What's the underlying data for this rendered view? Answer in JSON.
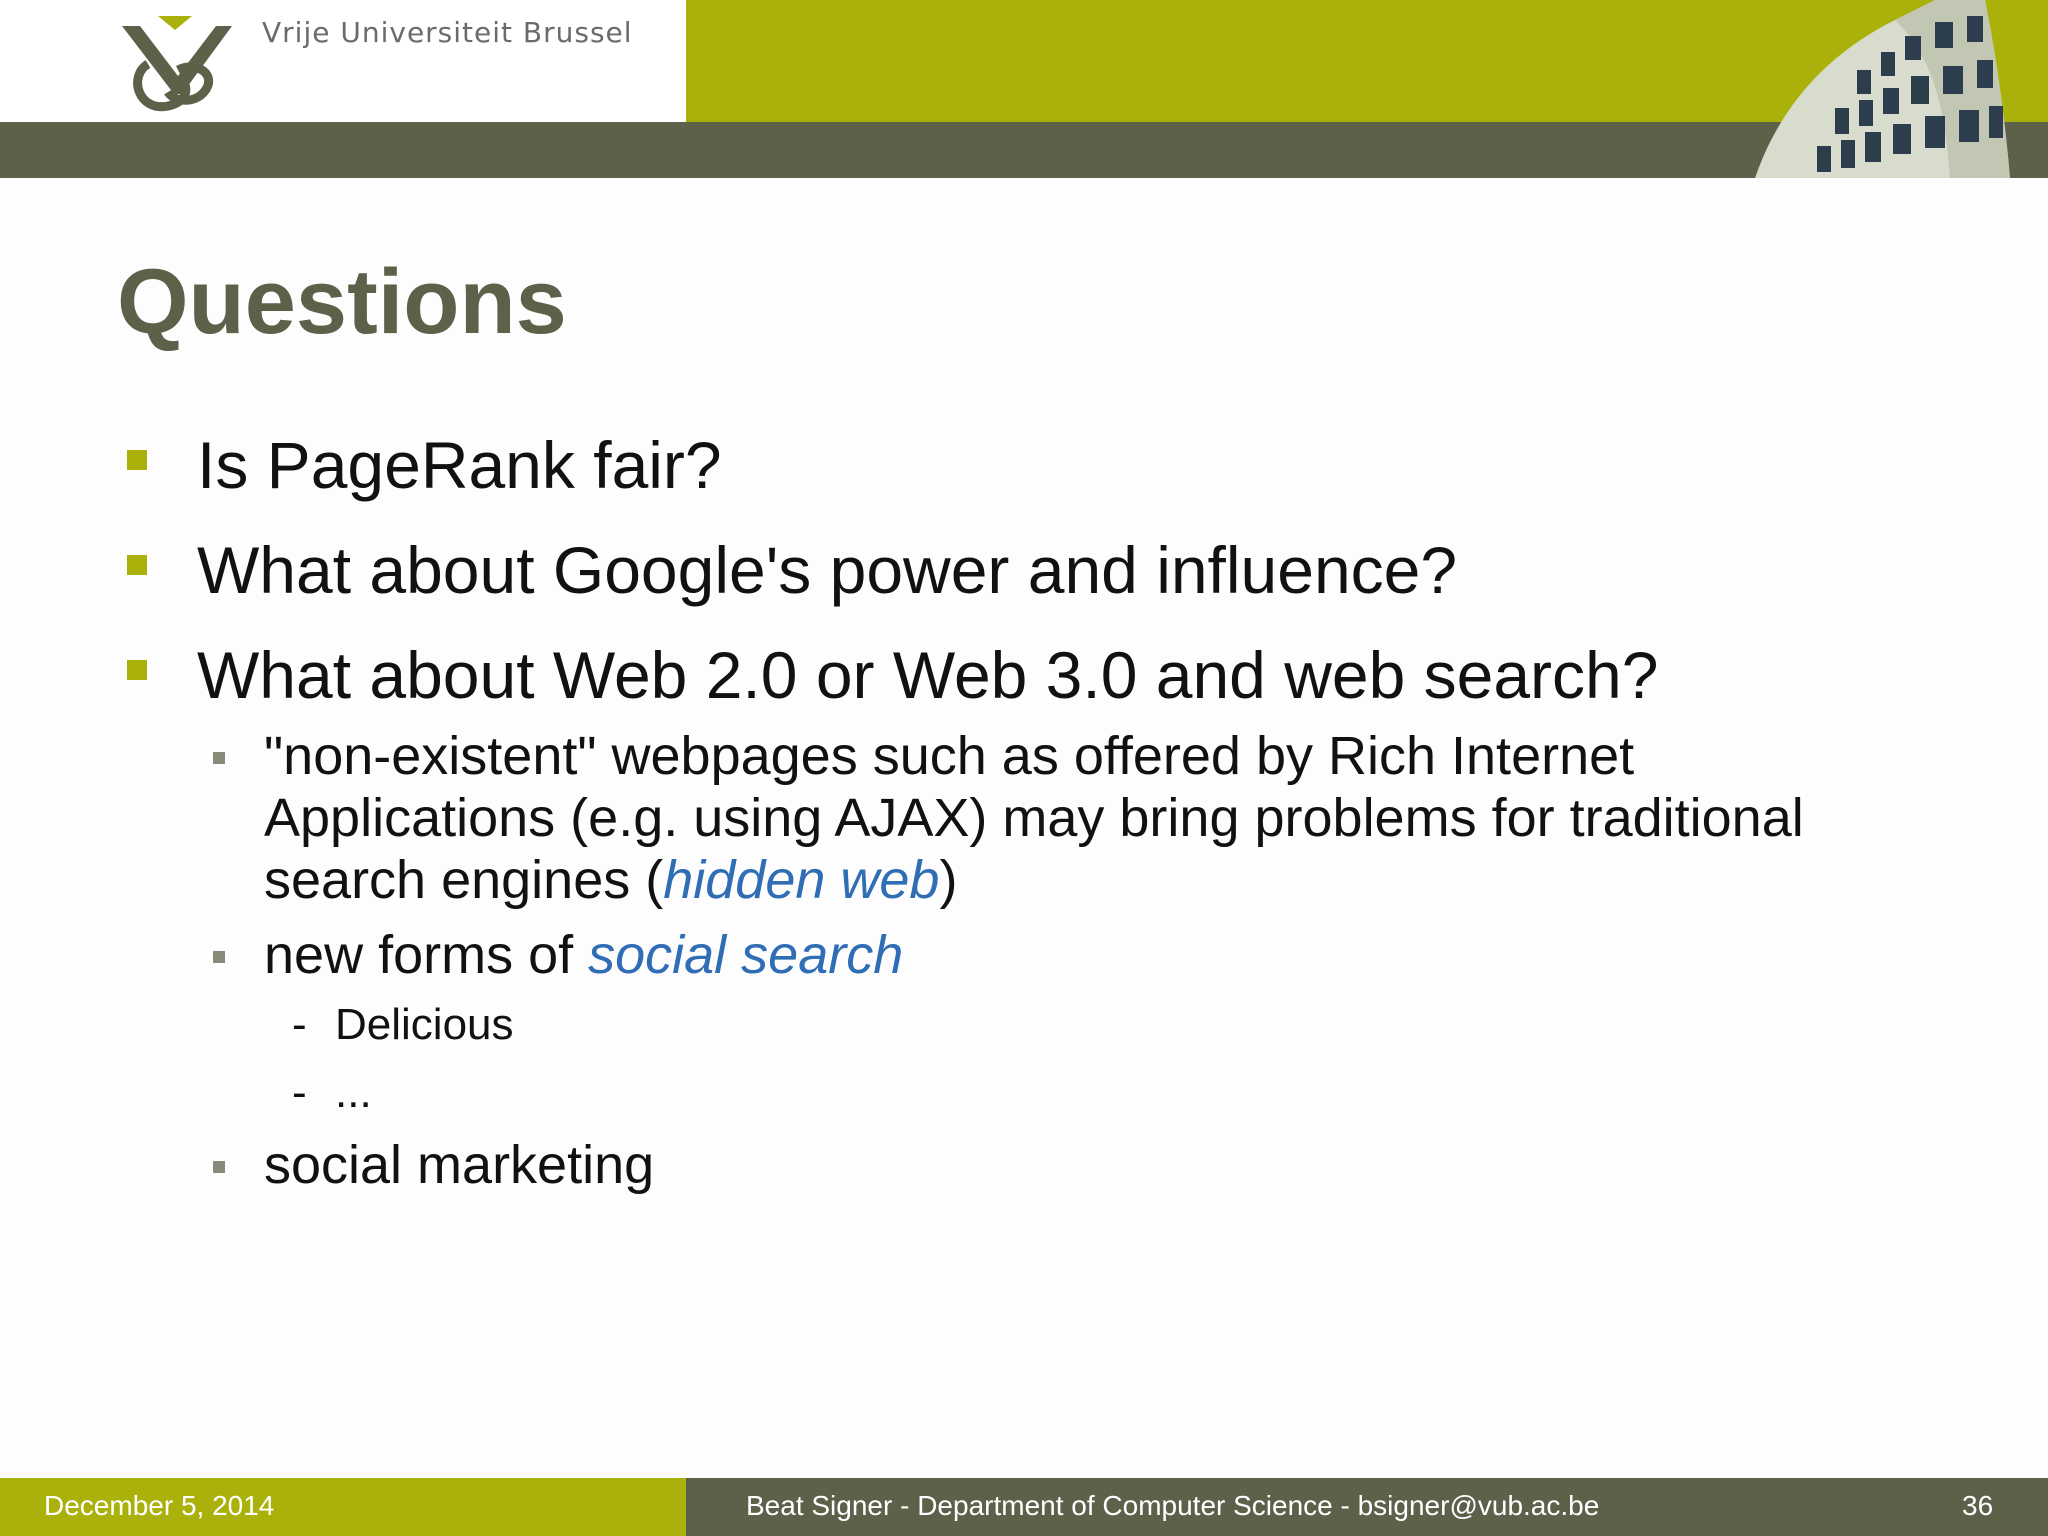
{
  "header": {
    "university": "Vrije Universiteit  Brussel"
  },
  "slide": {
    "title": "Questions",
    "bullets": [
      "Is PageRank fair?",
      "What about Google's power and influence?",
      "What about Web 2.0 or Web 3.0 and web search?"
    ],
    "sub": {
      "hidden_line1": "\"non-existent\" webpages such as offered by Rich Internet",
      "hidden_line2": "Applications (e.g. using AJAX) may bring problems for traditional",
      "hidden_line3_pre": "search engines (",
      "hidden_term": "hidden web",
      "hidden_line3_post": ")",
      "social_pre": "new forms of ",
      "social_term": "social search",
      "delicious": "Delicious",
      "ellipsis": "...",
      "marketing": "social marketing"
    },
    "dash": "-"
  },
  "footer": {
    "date": "December 5, 2014",
    "author": "Beat Signer - Department of Computer Science - bsigner@vub.ac.be",
    "page": "36"
  },
  "colors": {
    "accent_olive": "#aab10a",
    "dark_band": "#5d614a",
    "link_blue": "#2f6db5"
  }
}
